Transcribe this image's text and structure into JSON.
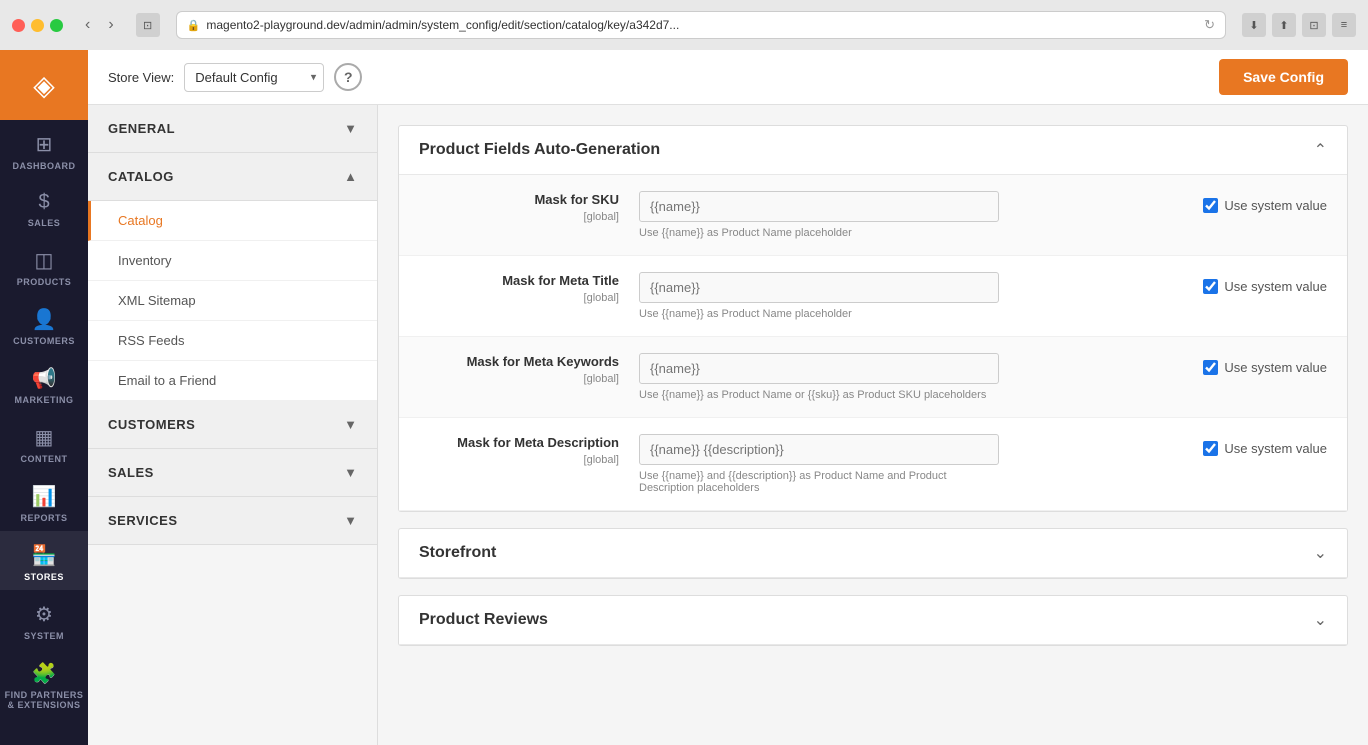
{
  "browser": {
    "url": "magento2-playground.dev/admin/admin/system_config/edit/section/catalog/key/a342d7..."
  },
  "topbar": {
    "store_view_label": "Store View:",
    "store_view_value": "Default Config",
    "help_label": "?",
    "save_button_label": "Save Config"
  },
  "sidebar": {
    "items": [
      {
        "id": "dashboard",
        "label": "DASHBOARD",
        "icon": "⊞"
      },
      {
        "id": "sales",
        "label": "SALES",
        "icon": "$"
      },
      {
        "id": "products",
        "label": "PRODUCTS",
        "icon": "◫"
      },
      {
        "id": "customers",
        "label": "CUSTOMERS",
        "icon": "👤"
      },
      {
        "id": "marketing",
        "label": "MARKETING",
        "icon": "📢"
      },
      {
        "id": "content",
        "label": "CONTENT",
        "icon": "▦"
      },
      {
        "id": "reports",
        "label": "REPORTS",
        "icon": "📊"
      },
      {
        "id": "stores",
        "label": "STORES",
        "icon": "🏪",
        "active": true
      },
      {
        "id": "system",
        "label": "SYSTEM",
        "icon": "⚙"
      },
      {
        "id": "find",
        "label": "FIND PARTNERS & EXTENSIONS",
        "icon": "🧩"
      }
    ]
  },
  "left_panel": {
    "sections": [
      {
        "id": "general",
        "title": "GENERAL",
        "expanded": false,
        "items": []
      },
      {
        "id": "catalog",
        "title": "CATALOG",
        "expanded": true,
        "items": [
          {
            "id": "catalog",
            "label": "Catalog",
            "active": true
          },
          {
            "id": "inventory",
            "label": "Inventory",
            "active": false
          },
          {
            "id": "xml-sitemap",
            "label": "XML Sitemap",
            "active": false
          },
          {
            "id": "rss-feeds",
            "label": "RSS Feeds",
            "active": false
          },
          {
            "id": "email-to-friend",
            "label": "Email to a Friend",
            "active": false
          }
        ]
      },
      {
        "id": "customers",
        "title": "CUSTOMERS",
        "expanded": false,
        "items": []
      },
      {
        "id": "sales",
        "title": "SALES",
        "expanded": false,
        "items": []
      },
      {
        "id": "services",
        "title": "SERVICES",
        "expanded": false,
        "items": []
      }
    ]
  },
  "main": {
    "sections": [
      {
        "id": "product-fields",
        "title": "Product Fields Auto-Generation",
        "collapsed": false,
        "fields": [
          {
            "id": "mask-sku",
            "label": "Mask for SKU",
            "scope": "[global]",
            "placeholder": "{{name}}",
            "hint": "Use {{name}} as Product Name placeholder",
            "use_system_value": true
          },
          {
            "id": "mask-meta-title",
            "label": "Mask for Meta Title",
            "scope": "[global]",
            "placeholder": "{{name}}",
            "hint": "Use {{name}} as Product Name placeholder",
            "use_system_value": true
          },
          {
            "id": "mask-meta-keywords",
            "label": "Mask for Meta Keywords",
            "scope": "[global]",
            "placeholder": "{{name}}",
            "hint": "Use {{name}} as Product Name or {{sku}} as Product SKU placeholders",
            "use_system_value": true
          },
          {
            "id": "mask-meta-description",
            "label": "Mask for Meta Description",
            "scope": "[global]",
            "placeholder": "{{name}} {{description}}",
            "hint": "Use {{name}} and {{description}} as Product Name and Product Description placeholders",
            "use_system_value": true
          }
        ]
      },
      {
        "id": "storefront",
        "title": "Storefront",
        "collapsed": true,
        "fields": []
      },
      {
        "id": "product-reviews",
        "title": "Product Reviews",
        "collapsed": true,
        "fields": []
      }
    ],
    "use_system_value_label": "Use system value"
  }
}
